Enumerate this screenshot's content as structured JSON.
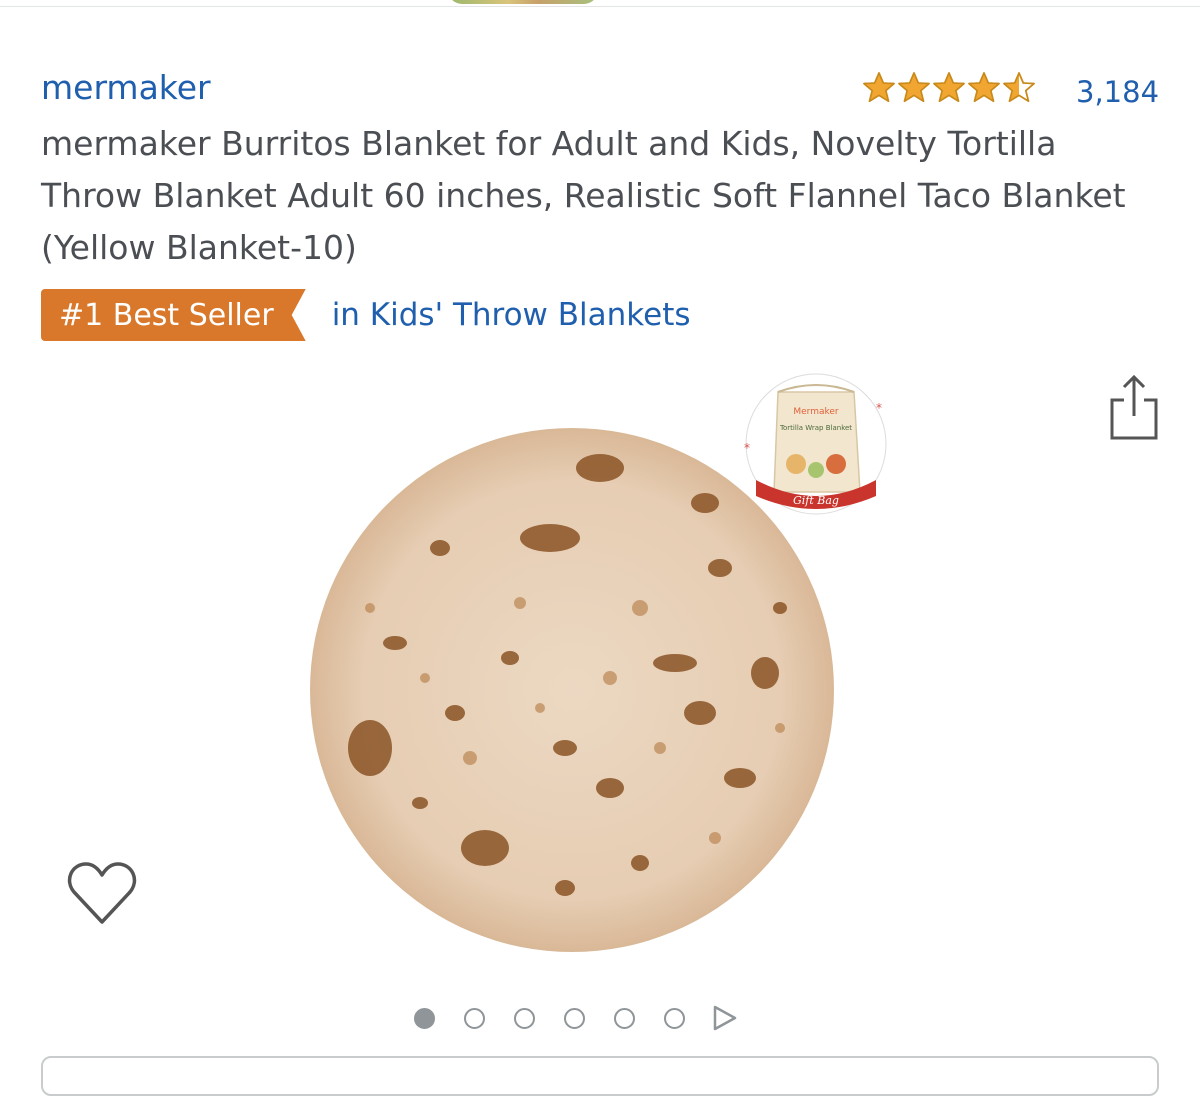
{
  "listing": {
    "brand": "mermaker",
    "rating_stars": 4.5,
    "review_count": "3,184",
    "title": "mermaker Burritos Blanket for Adult and Kids, Novelty Tortilla Throw Blanket Adult 60 inches, Realistic Soft Flannel Taco Blanket (Yellow Blanket-10)",
    "badge": {
      "label": "#1 Best Seller",
      "category": "in Kids' Throw Blankets"
    }
  },
  "gallery": {
    "gift_bag_label": "Gift Bag",
    "image_count": 6,
    "active_index": 0
  },
  "colors": {
    "link": "#1f5fae",
    "badge": "#d9782a",
    "star": "#f0a631",
    "dots": "#8f9598"
  },
  "icons": {
    "share": "share-icon",
    "wishlist": "heart-outline-icon",
    "next": "play-triangle-icon"
  }
}
